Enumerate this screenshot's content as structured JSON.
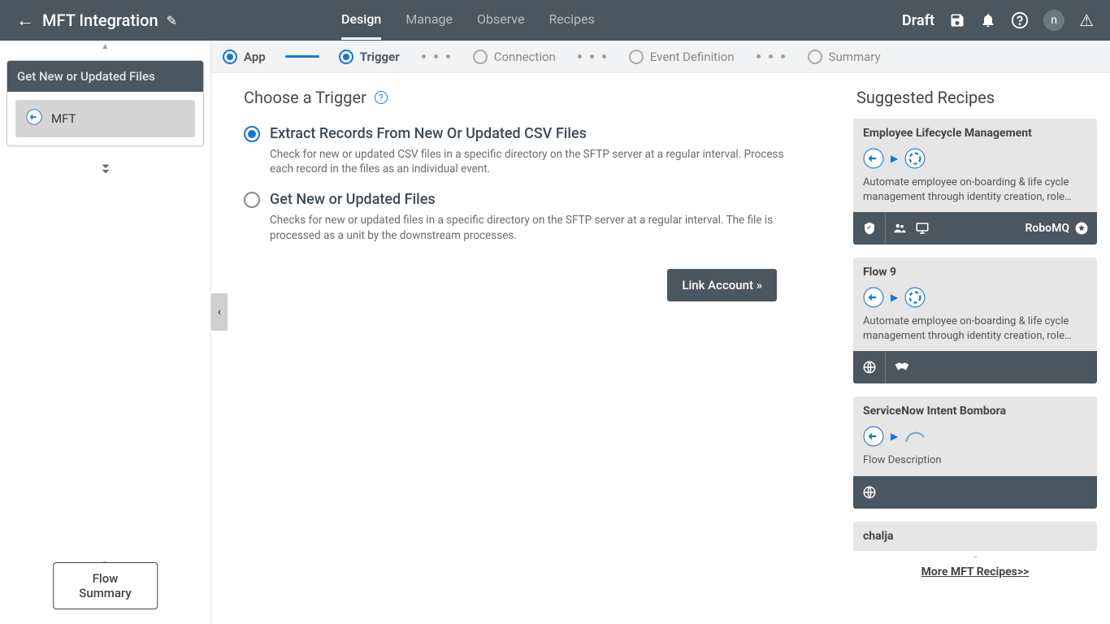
{
  "topbar": {
    "title": "MFT Integration",
    "tabs": [
      "Design",
      "Manage",
      "Observe",
      "Recipes"
    ],
    "active_tab": 0,
    "status": "Draft",
    "avatar_letter": "n"
  },
  "sidebar": {
    "card_title": "Get New or Updated Files",
    "item_label": "MFT",
    "flow_summary_btn": "Flow Summary"
  },
  "stepper": {
    "steps": [
      "App",
      "Trigger",
      "Connection",
      "Event Definition",
      "Summary"
    ]
  },
  "form": {
    "title": "Choose a Trigger",
    "options": [
      {
        "label": "Extract Records From New Or Updated CSV Files",
        "desc": "Check for new or updated CSV files in a specific directory on the SFTP server at a regular interval. Process each record in the files as an individual event.",
        "selected": true
      },
      {
        "label": "Get New or Updated Files",
        "desc": "Checks for new or updated files in a specific directory on the SFTP server at a regular interval. The file is processed as a unit by the downstream processes.",
        "selected": false
      }
    ],
    "link_account_btn": "Link Account »"
  },
  "suggestions": {
    "title": "Suggested Recipes",
    "recipes": [
      {
        "name": "Employee Lifecycle Management",
        "desc": "Automate employee on-boarding & life cycle management through identity creation, role…",
        "footer_vendor": "RoboMQ",
        "footer_icons": [
          "shield",
          "users",
          "monitor"
        ]
      },
      {
        "name": "Flow 9",
        "desc": "Automate employee on-boarding & life cycle management through identity creation, role…",
        "footer_vendor": "",
        "footer_icons": [
          "globe",
          "handshake"
        ]
      },
      {
        "name": "ServiceNow Intent Bombora",
        "desc": "Flow Description",
        "footer_vendor": "",
        "footer_icons": [
          "globe"
        ]
      },
      {
        "name": "chalja",
        "desc": "",
        "footer_vendor": "",
        "footer_icons": []
      }
    ],
    "more_link": "More MFT Recipes>>"
  }
}
